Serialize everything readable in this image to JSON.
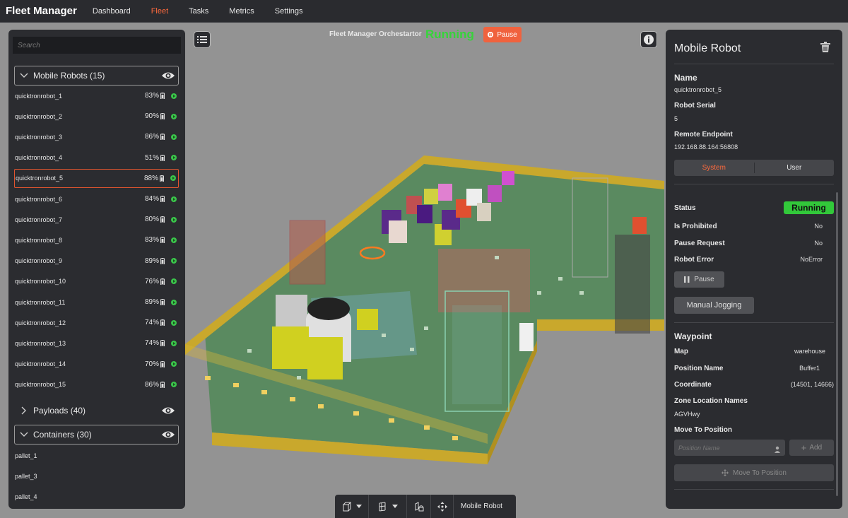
{
  "app": {
    "title": "Fleet Manager"
  },
  "nav": [
    {
      "label": "Dashboard",
      "active": false
    },
    {
      "label": "Fleet",
      "active": true
    },
    {
      "label": "Tasks",
      "active": false
    },
    {
      "label": "Metrics",
      "active": false
    },
    {
      "label": "Settings",
      "active": false
    }
  ],
  "colors": {
    "accent": "#ff6a3d",
    "running": "#36d43a",
    "pause": "#f0623e",
    "panel": "#2b2c30"
  },
  "left": {
    "search_placeholder": "Search",
    "mobile_robots": {
      "label": "Mobile Robots (15)"
    },
    "robots": [
      {
        "name": "quicktronrobot_1",
        "battery": "83%"
      },
      {
        "name": "quicktronrobot_2",
        "battery": "90%"
      },
      {
        "name": "quicktronrobot_3",
        "battery": "86%"
      },
      {
        "name": "quicktronrobot_4",
        "battery": "51%"
      },
      {
        "name": "quicktronrobot_5",
        "battery": "88%"
      },
      {
        "name": "quicktronrobot_6",
        "battery": "84%"
      },
      {
        "name": "quicktronrobot_7",
        "battery": "80%"
      },
      {
        "name": "quicktronrobot_8",
        "battery": "83%"
      },
      {
        "name": "quicktronrobot_9",
        "battery": "89%"
      },
      {
        "name": "quicktronrobot_10",
        "battery": "76%"
      },
      {
        "name": "quicktronrobot_11",
        "battery": "89%"
      },
      {
        "name": "quicktronrobot_12",
        "battery": "74%"
      },
      {
        "name": "quicktronrobot_13",
        "battery": "74%"
      },
      {
        "name": "quicktronrobot_14",
        "battery": "70%"
      },
      {
        "name": "quicktronrobot_15",
        "battery": "86%"
      }
    ],
    "selected_robot": "quicktronrobot_5",
    "payloads": {
      "label": "Payloads (40)"
    },
    "containers": {
      "label": "Containers (30)"
    },
    "pallets": [
      "pallet_1",
      "pallet_3",
      "pallet_4"
    ]
  },
  "center": {
    "orchestrator_label": "Fleet Manager Orchestartor",
    "status": "Running",
    "pause_label": "Pause",
    "menu_icon": "list-icon",
    "info_icon": "info-icon"
  },
  "detail": {
    "title": "Mobile Robot",
    "name_label": "Name",
    "name": "quicktronrobot_5",
    "serial_label": "Robot Serial",
    "serial": "5",
    "endpoint_label": "Remote Endpoint",
    "endpoint": "192.168.88.164:56808",
    "tabs": {
      "system": "System",
      "user": "User"
    },
    "status_label": "Status",
    "status": "Running",
    "prohibited_label": "Is Prohibited",
    "prohibited": "No",
    "pause_req_label": "Pause Request",
    "pause_req": "No",
    "error_label": "Robot Error",
    "error": "NoError",
    "pause_btn": "Pause",
    "manual_btn": "Manual Jogging",
    "waypoint_label": "Waypoint",
    "map_label": "Map",
    "map": "warehouse",
    "posname_label": "Position Name",
    "posname": "Buffer1",
    "coord_label": "Coordinate",
    "coord": "(14501, 14666)",
    "zone_label": "Zone Location Names",
    "zone": "AGVHwy",
    "move_label": "Move To Position",
    "pos_placeholder": "Position Name",
    "add_btn": "Add",
    "move_btn": "Move To Position"
  },
  "bottom": {
    "view_label": "Mobile Robot",
    "icons": [
      "cube-icon",
      "shelf-icon",
      "robot-lock-icon",
      "move-icon"
    ]
  }
}
